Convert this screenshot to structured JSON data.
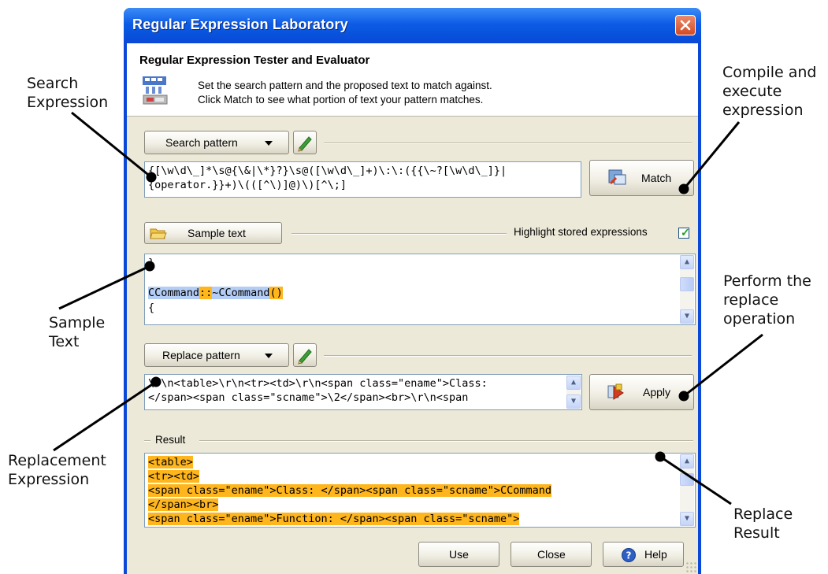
{
  "annotations": {
    "search_expression": "Search\nExpression",
    "compile_execute": "Compile and\nexecute\nexpression",
    "sample_text": "Sample\nText",
    "perform_replace": "Perform the\nreplace\noperation",
    "replacement_expression": "Replacement\nExpression",
    "replace_result": "Replace\nResult"
  },
  "window": {
    "title": "Regular Expression Laboratory",
    "title_bar_color": "#0a48d8",
    "close_icon": "close-icon"
  },
  "header": {
    "title": "Regular Expression Tester and Evaluator",
    "line1": "Set the search pattern and the proposed text to match against.",
    "line2": "Click Match to see what portion of text your pattern matches.",
    "icon": "regex-lab-icon"
  },
  "search": {
    "pattern_button": "Search pattern",
    "pattern_lines": [
      "{[\\w\\d\\_]*\\s@{\\&|\\*}?}\\s@([\\w\\d\\_]+)\\:\\:({{\\~?[\\w\\d\\_]}|",
      "{operator.}}+)\\(([^\\)]@)\\)[^\\;]"
    ],
    "match_button": "Match"
  },
  "sample": {
    "button": "Sample text",
    "highlight_label": "Highlight stored expressions",
    "highlight_checked": true,
    "lines": [
      {
        "segments": [
          {
            "text": "}",
            "style": ""
          }
        ]
      },
      {
        "segments": [
          {
            "text": "",
            "style": ""
          }
        ]
      },
      {
        "segments": [
          {
            "text": "CCommand",
            "style": "blue"
          },
          {
            "text": "::",
            "style": "orange"
          },
          {
            "text": "~CCommand",
            "style": "blue"
          },
          {
            "text": "()",
            "style": "orange"
          }
        ]
      },
      {
        "segments": [
          {
            "text": "{",
            "style": ""
          }
        ]
      }
    ]
  },
  "replace": {
    "pattern_button": "Replace pattern",
    "pattern_lines": [
      "\\r\\n<table>\\r\\n<tr><td>\\r\\n<span class=\"ename\">Class:",
      "</span><span class=\"scname\">\\2</span><br>\\r\\n<span"
    ],
    "apply_button": "Apply"
  },
  "result": {
    "label": "Result",
    "lines": [
      "<table>",
      "<tr><td>",
      "<span class=\"ename\">Class: </span><span class=\"scname\">CCommand",
      "</span><br>",
      "<span class=\"ename\">Function: </span><span class=\"scname\">"
    ],
    "highlight_color": "#ffb51c"
  },
  "footer": {
    "use_button": "Use",
    "close_button": "Close",
    "help_button": "Help"
  }
}
